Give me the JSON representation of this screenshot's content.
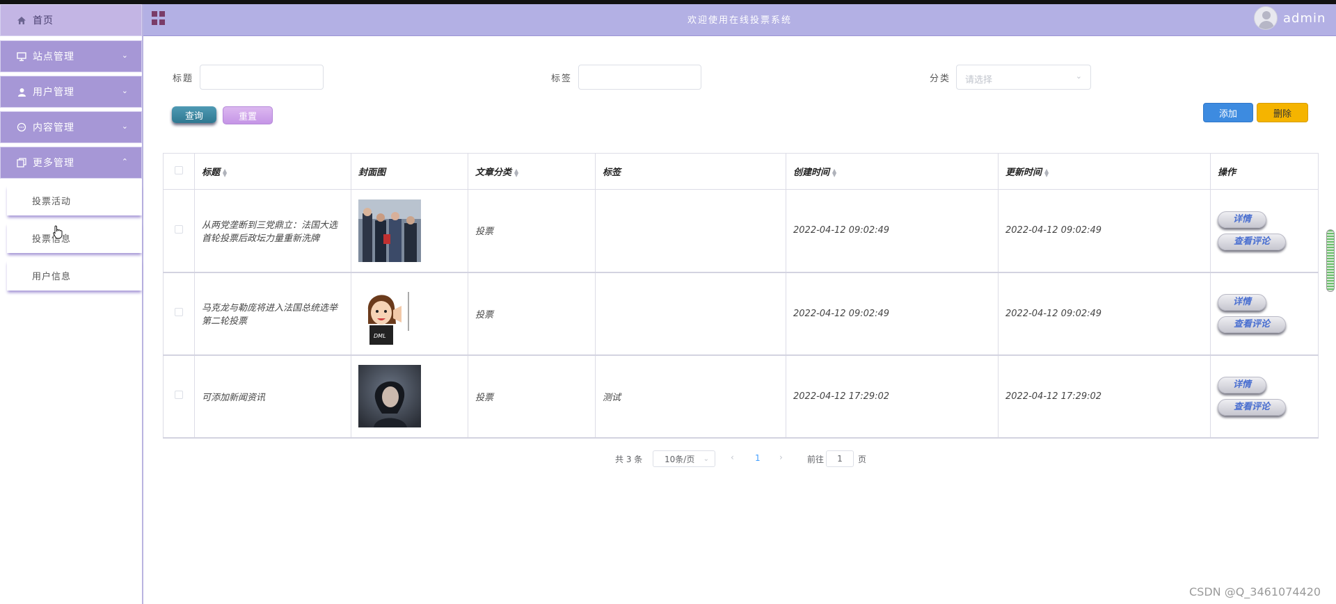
{
  "header": {
    "title": "欢迎使用在线投票系统",
    "username": "admin"
  },
  "sidebar": {
    "home": "首页",
    "items": [
      {
        "label": "站点管理",
        "icon": "monitor-icon"
      },
      {
        "label": "用户管理",
        "icon": "user-icon"
      },
      {
        "label": "内容管理",
        "icon": "chat-icon"
      },
      {
        "label": "更多管理",
        "icon": "copy-icon"
      }
    ],
    "sub_items": [
      "投票活动",
      "投票信息",
      "用户信息"
    ]
  },
  "search": {
    "title_label": "标题",
    "tag_label": "标签",
    "category_label": "分类",
    "category_placeholder": "请选择",
    "search_button": "查询",
    "reset_button": "重置"
  },
  "actions": {
    "add_button": "添加",
    "delete_button": "删除"
  },
  "table": {
    "columns": [
      "标题",
      "封面图",
      "文章分类",
      "标签",
      "创建时间",
      "更新时间",
      "操作"
    ],
    "rows": [
      {
        "title": "从两党垄断到三党鼎立：法国大选首轮投票后政坛力量重新洗牌",
        "category": "投票",
        "tag": "",
        "created": "2022-04-12 09:02:49",
        "updated": "2022-04-12 09:02:49",
        "cover": "news-photo-crowd"
      },
      {
        "title": "马克龙与勒庞将进入法国总统选举第二轮投票",
        "category": "投票",
        "tag": "",
        "created": "2022-04-12 09:02:49",
        "updated": "2022-04-12 09:02:49",
        "cover": "cartoon-girl"
      },
      {
        "title": "可添加新闻资讯",
        "category": "投票",
        "tag": "测试",
        "created": "2022-04-12 17:29:02",
        "updated": "2022-04-12 17:29:02",
        "cover": "portrait-photo"
      }
    ],
    "detail_button": "详情",
    "comment_button": "查看评论"
  },
  "pagination": {
    "total": "共 3 条",
    "page_size": "10条/页",
    "current_page": "1",
    "goto_label": "前往",
    "goto_value": "1",
    "page_unit": "页"
  },
  "watermark": "CSDN @Q_3461074420",
  "colors": {
    "sidebar": "#a697d6",
    "header": "#b3b0e4",
    "add": "#3d8be0",
    "delete": "#f5b400"
  }
}
